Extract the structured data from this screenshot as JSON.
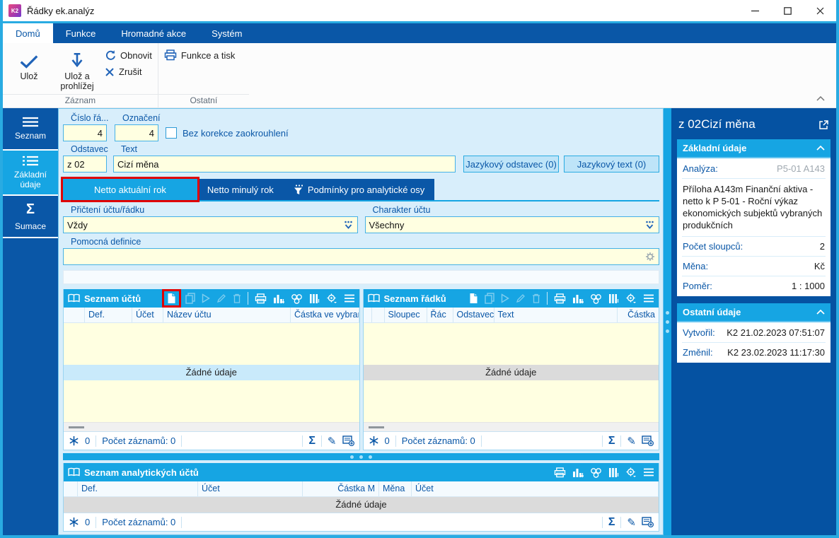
{
  "window": {
    "logo_text": "K2",
    "title": "Řádky ek.analýz"
  },
  "ribbon": {
    "tabs": [
      {
        "label": "Domů",
        "active": true
      },
      {
        "label": "Funkce"
      },
      {
        "label": "Hromadné akce"
      },
      {
        "label": "Systém"
      }
    ],
    "save_label": "Ulož",
    "save_view_label": "Ulož a prohlížej",
    "refresh_label": "Obnovit",
    "cancel_label": "Zrušit",
    "func_print_label": "Funkce a tisk",
    "group_record_label": "Záznam",
    "group_other_label": "Ostatní"
  },
  "sidebar": {
    "items": [
      {
        "label": "Seznam"
      },
      {
        "label": "Základní údaje",
        "active": true
      },
      {
        "label": "Sumace"
      }
    ]
  },
  "form": {
    "cislo": {
      "label": "Číslo řá...",
      "value": "4"
    },
    "oznaceni": {
      "label": "Označení",
      "value": "4"
    },
    "bez_korekce_label": "Bez korekce zaokrouhlení",
    "odstavec": {
      "label": "Odstavec",
      "value": "z 02"
    },
    "text": {
      "label": "Text",
      "value": "Cizí měna"
    },
    "jazykovy_odstavec_label": "Jazykový odstavec (0)",
    "jazykovy_text_label": "Jazykový text (0)",
    "tabs": [
      {
        "label": "Netto aktuální rok",
        "active": true,
        "highlighted": true
      },
      {
        "label": "Netto minulý rok"
      },
      {
        "label": "Podmínky pro analytické osy"
      }
    ],
    "prichteni": {
      "label": "Přičtení účtu/řádku",
      "value": "Vždy"
    },
    "charakter": {
      "label": "Charakter účtu",
      "value": "Všechny"
    },
    "pomocna": {
      "label": "Pomocná definice",
      "value": ""
    }
  },
  "tables": {
    "ucty": {
      "title": "Seznam účtů",
      "columns": [
        "",
        "Def.",
        "Účet",
        "Název účtu",
        "Částka ve vybran"
      ],
      "empty_text": "Žádné údaje",
      "footer": {
        "flag": "0",
        "count": "Počet záznamů: 0"
      }
    },
    "radky": {
      "title": "Seznam řádků",
      "columns": [
        "",
        "",
        "Sloupec",
        "Řác",
        "Odstavec",
        "Text",
        "Částka"
      ],
      "empty_text": "Žádné údaje",
      "footer": {
        "flag": "0",
        "count": "Počet záznamů: 0"
      }
    },
    "analyticke": {
      "title": "Seznam analytických účtů",
      "columns": [
        "",
        "Def.",
        "Účet",
        "Částka M",
        "Měna",
        "Účet"
      ],
      "empty_text": "Žádné údaje",
      "footer": {
        "flag": "0",
        "count": "Počet záznamů: 0"
      }
    }
  },
  "right_panel": {
    "title": "z 02Cizí měna",
    "sections": [
      {
        "title": "Základní údaje",
        "rows": [
          {
            "label": "Analýza:",
            "value": "P5-01 A143"
          },
          {
            "text": "Příloha A143m Finanční aktiva - netto k P 5-01 - Roční výkaz ekonomických subjektů vybraných produkčních"
          },
          {
            "label": "Počet sloupců:",
            "value": "2"
          },
          {
            "label": "Měna:",
            "value": "Kč"
          },
          {
            "label": "Poměr:",
            "value": "1 : 1000"
          }
        ]
      },
      {
        "title": "Ostatní údaje",
        "rows": [
          {
            "label": "Vytvořil:",
            "value": "K2 21.02.2023 07:51:07"
          },
          {
            "label": "Změnil:",
            "value": "K2 23.02.2023 11:17:30"
          }
        ]
      }
    ]
  },
  "colors": {
    "accent_cyan": "#16A5E3",
    "dark_blue": "#0A57A7",
    "field_yellow": "#FFFFE1",
    "highlight_red": "#E00000",
    "content_bg": "#D8EEFB"
  }
}
